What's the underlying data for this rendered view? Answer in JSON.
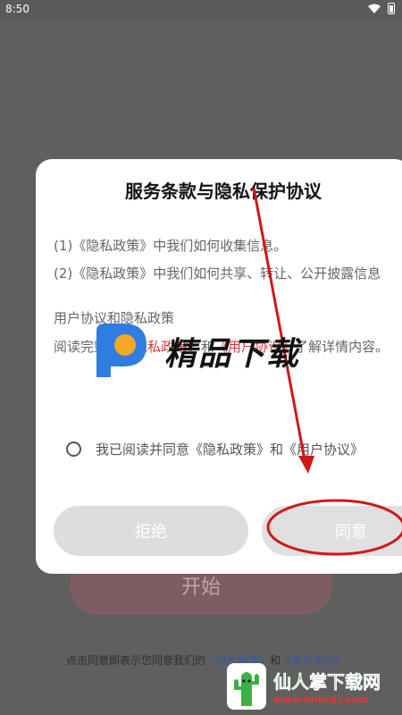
{
  "status_bar": {
    "time": "8:50"
  },
  "background": {
    "start_button": "开始",
    "footer_prefix": "点击同意即表示您同意我们的",
    "footer_privacy": "《隐私政策》",
    "footer_and": "和",
    "footer_agreement": "《用户协议》"
  },
  "dialog": {
    "title": "服务条款与隐私保护协议",
    "item1": "(1)《隐私政策》中我们如何收集信息。",
    "item2": "(2)《隐私政策》中我们如何共享、转让、公开披露信息",
    "para_line1": "用户协议和隐私政策",
    "para_read": "阅读完整的",
    "para_privacy": "《隐私政策》",
    "para_and": "和",
    "para_agreement": "《用户协议》",
    "para_rest": "了解详情内容。",
    "consent": "我已阅读并同意《隐私政策》和《用户协议》",
    "reject": "拒绝",
    "agree": "同意"
  },
  "watermarks": {
    "center_text": "精品下载",
    "bottom_title": "仙人掌下载网",
    "bottom_url": "www.hnbrgc.com"
  },
  "colors": {
    "overlay": "#5f5f5f",
    "link_red": "#d43b3b",
    "annotation_red": "#d01818"
  }
}
